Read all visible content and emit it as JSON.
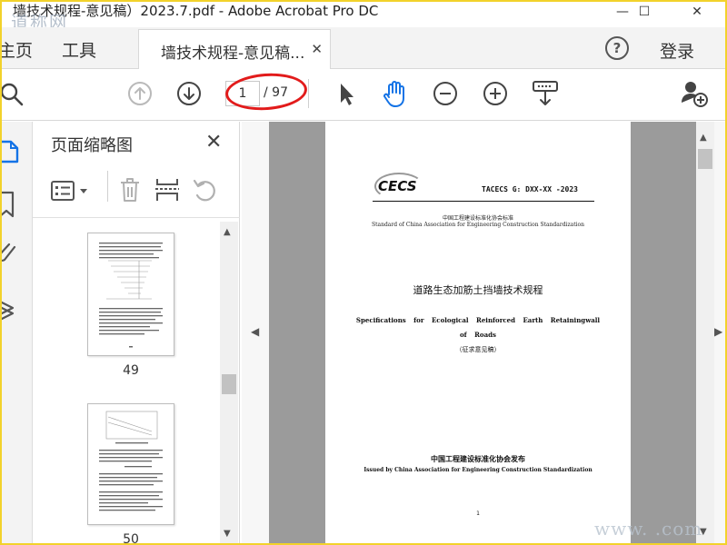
{
  "window": {
    "title": "墙技术规程-意见稿）2023.7.pdf - Adobe Acrobat Pro DC",
    "minimize": "—",
    "maximize": "☐",
    "close": "✕"
  },
  "watermark": {
    "top": "道称网",
    "bottom": "www.        .com"
  },
  "tabs": {
    "home": "主页",
    "tools": "工具",
    "document": "墙技术规程-意见稿...",
    "document_close": "✕",
    "help": "?",
    "login": "登录"
  },
  "toolbar": {
    "current_page": "1",
    "total_pages": "/ 97",
    "icons": [
      "search-icon",
      "prev-page-icon",
      "next-page-icon",
      "select-arrow-icon",
      "hand-tool-icon",
      "zoom-out-icon",
      "zoom-in-icon",
      "page-view-icon",
      "share-user-icon"
    ]
  },
  "thumbnails_panel": {
    "title": "页面缩略图",
    "close": "✕",
    "pages": [
      {
        "number": "49"
      },
      {
        "number": "50"
      }
    ]
  },
  "pdf_page": {
    "logo": "CECS",
    "code": "TACECS G: DXX-XX -2023",
    "assoc_cn": "中国工程建设标准化协会标准",
    "assoc_en": "Standard of China Association for Engineering Construction Standardization",
    "title_cn": "道路生态加筋土挡墙技术规程",
    "title_en_line1": "Specifications   for   Ecological Reinforced Earth Retainingwall",
    "title_en_line2": "of   Roads",
    "draft": "（征求意见稿）",
    "publisher_cn": "中国工程建设标准化协会发布",
    "publisher_en": "Issued by China Association for Engineering Construction Standardization",
    "page_number": "1"
  },
  "colors": {
    "frame": "#f2d22b",
    "annotation_ellipse": "#e21b1b",
    "accent_blue": "#1473e6",
    "pdf_background": "#9b9b9b"
  }
}
